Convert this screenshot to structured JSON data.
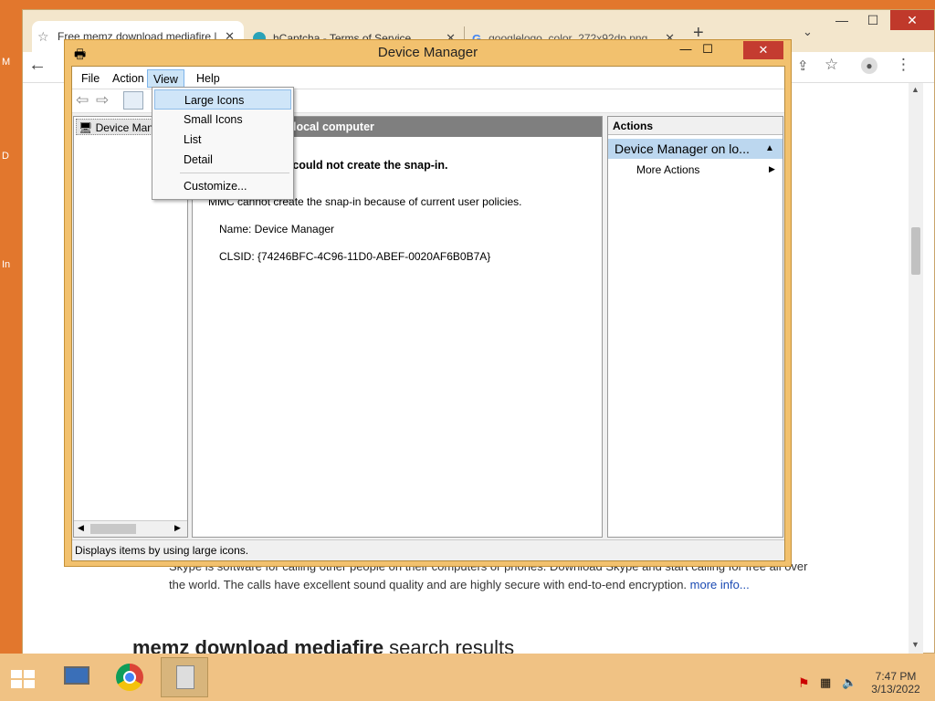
{
  "desktop": {
    "letters": [
      "M",
      "D",
      "In"
    ]
  },
  "chrome": {
    "tabs": [
      {
        "title": "Free memz download mediafire |",
        "icon": "star-icon"
      },
      {
        "title": "hCaptcha - Terms of Service",
        "icon": "hcaptcha-icon"
      },
      {
        "title": "googlelogo_color_272x92dp.png",
        "icon": "google-g-icon"
      }
    ],
    "new_tab": "+",
    "tab_close": "✕",
    "window_controls": {
      "minimize": "—",
      "maximize": "☐",
      "close": "✕"
    },
    "page": {
      "snippet": "Skype is software for calling other people on their computers or phones. Download Skype and start calling for free all over the world. The calls have excellent sound quality and are highly secure with end-to-end encryption.",
      "more": "more info...",
      "results_heading_bold": "memz download mediafire",
      "results_heading_rest": " search results"
    }
  },
  "dm": {
    "title": "Device Manager",
    "menu": [
      "File",
      "Action",
      "View",
      "Help"
    ],
    "tree_item": "Device Manager",
    "mid_header": "local computer",
    "error_title": "MMC could not create the snap-in.",
    "error_body": "MMC cannot create the snap-in because of current user policies.",
    "name_line": "Name: Device Manager",
    "clsid_line": "CLSID: {74246BFC-4C96-11D0-ABEF-0020AF6B0B7A}",
    "actions_header": "Actions",
    "actions_selected": "Device Manager on lo...",
    "more_actions": "More Actions",
    "status": "Displays items by using large icons.",
    "view_menu": [
      "Large Icons",
      "Small Icons",
      "List",
      "Detail",
      "Customize..."
    ]
  },
  "taskbar": {
    "time": "7:47 PM",
    "date": "3/13/2022"
  }
}
